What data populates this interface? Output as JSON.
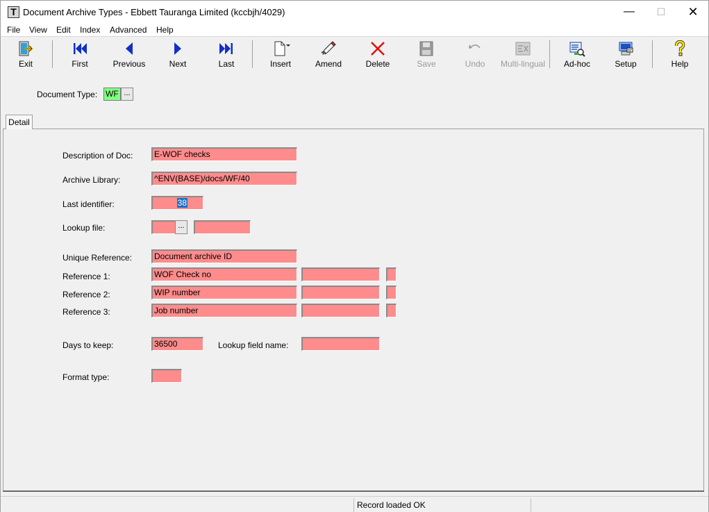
{
  "window": {
    "title": "Document Archive Types - Ebbett Tauranga Limited (kccbjh/4029)",
    "app_icon_letter": "T",
    "minimize": "—",
    "maximize": "☐",
    "close": "✕"
  },
  "menu": [
    "File",
    "View",
    "Edit",
    "Index",
    "Advanced",
    "Help"
  ],
  "toolbar": {
    "exit": "Exit",
    "first": "First",
    "previous": "Previous",
    "next": "Next",
    "last": "Last",
    "insert": "Insert",
    "amend": "Amend",
    "delete": "Delete",
    "save": "Save",
    "undo": "Undo",
    "multilingual": "Multi-lingual",
    "adhoc": "Ad-hoc",
    "setup": "Setup",
    "help": "Help"
  },
  "header": {
    "doc_type_label": "Document Type:",
    "doc_type_value": "WF",
    "lookup_glyph": "..."
  },
  "tabs": [
    "Detail"
  ],
  "form": {
    "description_label": "Description of Doc:",
    "description_value": "E-WOF checks",
    "archive_library_label": "Archive Library:",
    "archive_library_value": "^ENV(BASE)/docs/WF/40",
    "last_identifier_label": "Last identifier:",
    "last_identifier_value": "38",
    "lookup_file_label": "Lookup file:",
    "lookup_file_value": "",
    "lookup_file_desc": "",
    "unique_reference_label": "Unique Reference:",
    "unique_reference_value": "Document archive ID",
    "reference_1_label": "Reference 1:",
    "reference_1_value": "WOF Check no",
    "reference_2_label": "Reference 2:",
    "reference_2_value": "WIP number",
    "reference_3_label": "Reference 3:",
    "reference_3_value": "Job number",
    "days_to_keep_label": "Days to keep:",
    "days_to_keep_value": "36500",
    "lookup_field_name_label": "Lookup field name:",
    "lookup_field_name_value": "",
    "format_type_label": "Format type:",
    "format_type_value": ""
  },
  "status": {
    "message": "Record loaded OK"
  },
  "colors": {
    "required_field": "#ff8c8c",
    "key_field": "#80ff80",
    "selection": "#1e6ec8"
  }
}
